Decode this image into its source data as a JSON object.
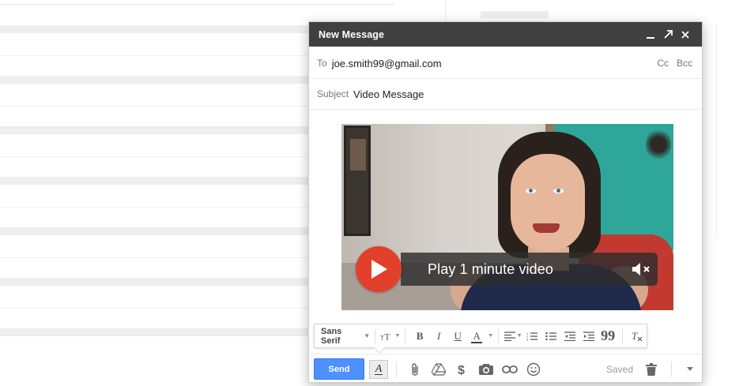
{
  "compose": {
    "title": "New Message",
    "window_controls": {
      "minimize_icon": "minimize-icon",
      "popout_icon": "popout-icon",
      "close_icon": "close-icon"
    },
    "to": {
      "label": "To",
      "value": "joe.smith99@gmail.com",
      "cc_label": "Cc",
      "bcc_label": "Bcc"
    },
    "subject": {
      "label": "Subject",
      "value": "Video Message"
    },
    "video": {
      "cta_label": "Play 1 minute video",
      "play_icon": "play-icon",
      "mute_icon": "mute-icon",
      "accent_color": "#e2402b"
    },
    "format_toolbar": {
      "font": "Sans Serif",
      "bold": "B",
      "italic": "I",
      "underline": "U",
      "text_color": "A",
      "quote": "99",
      "icons": [
        "text-size-icon",
        "align-icon",
        "numbered-list-icon",
        "bulleted-list-icon",
        "indent-less-icon",
        "indent-more-icon",
        "remove-formatting-icon"
      ]
    },
    "bottom_bar": {
      "send_label": "Send",
      "format_toggle": "A",
      "icons": [
        "attach-icon",
        "drive-icon",
        "money-icon",
        "photo-icon",
        "link-icon",
        "emoji-icon",
        "trash-icon",
        "more-options-icon"
      ],
      "status": "Saved"
    },
    "colors": {
      "titlebar": "#404040",
      "send": "#4d90fe"
    }
  }
}
